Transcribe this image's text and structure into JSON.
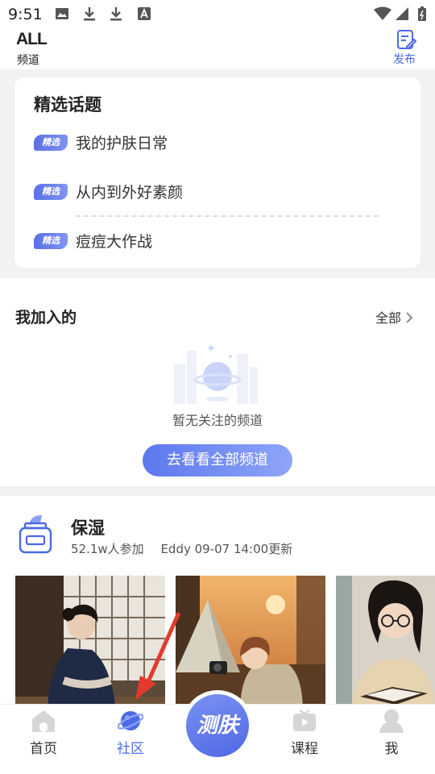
{
  "status_bar": {
    "time": "9:51",
    "icons": [
      "image-icon",
      "download-icon",
      "download-icon",
      "font-icon",
      "wifi-icon",
      "signal-icon",
      "battery-icon"
    ]
  },
  "header": {
    "logo_text": "ALL",
    "channel_label": "频道",
    "publish_label": "发布",
    "accent_color": "#4a6ae6"
  },
  "featured_topics": {
    "title": "精选话题",
    "badge_label": "精选",
    "items": [
      {
        "label": "我的护肤日常"
      },
      {
        "label": "从内到外好素颜"
      },
      {
        "label": "痘痘大作战"
      }
    ]
  },
  "joined": {
    "title": "我加入的",
    "all_label": "全部",
    "empty_text": "暂无关注的频道",
    "browse_button": "去看看全部频道"
  },
  "channel_card": {
    "name": "保湿",
    "participants": "52.1w人参加",
    "updated": "Eddy  09-07 14:00更新",
    "photos": [
      "kimono-woman-photo",
      "camping-woman-photo",
      "reading-woman-photo"
    ]
  },
  "bottom_nav": {
    "items": [
      {
        "label": "首页",
        "icon": "home-icon",
        "active": false
      },
      {
        "label": "社区",
        "icon": "planet-icon",
        "active": true
      },
      {
        "label": "课程",
        "icon": "video-icon",
        "active": false
      },
      {
        "label": "我",
        "icon": "user-icon",
        "active": false
      }
    ],
    "center_button": "测肤",
    "active_color": "#4a6ae6"
  }
}
